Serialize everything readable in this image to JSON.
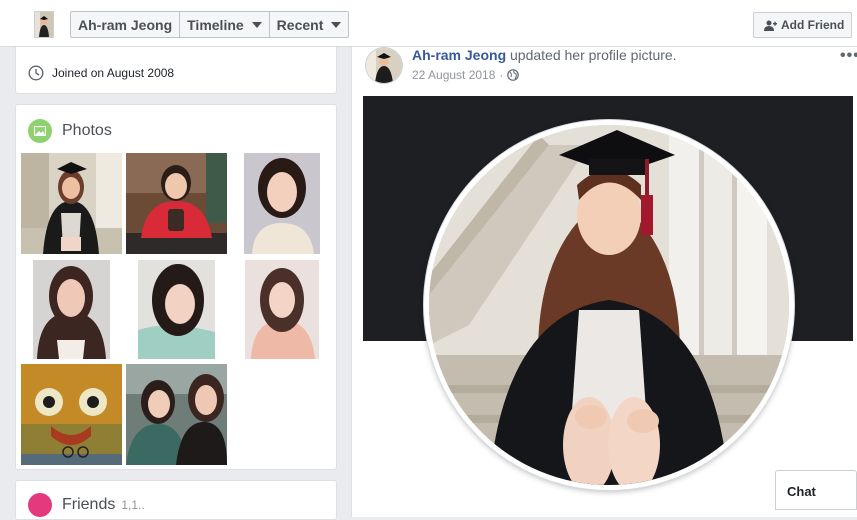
{
  "topbar": {
    "breadcrumbs": [
      {
        "label": "Ah-ram Jeong",
        "dropdown": false
      },
      {
        "label": "Timeline",
        "dropdown": true
      },
      {
        "label": "Recent",
        "dropdown": true
      }
    ],
    "add_friend_label": "Add Friend"
  },
  "sidebar": {
    "joined_text": "Joined on August 2008",
    "photos_title": "Photos",
    "friends_title": "Friends",
    "friends_count": "1,1.."
  },
  "post": {
    "author": "Ah-ram Jeong",
    "action": "updated her profile picture.",
    "date": "22 August 2018",
    "more": "•••"
  },
  "chat": {
    "label": "Chat"
  },
  "colors": {
    "link": "#385898",
    "background": "#e9ebee",
    "photos_icon": "#8ed16f",
    "friends_icon": "#e4397a"
  }
}
